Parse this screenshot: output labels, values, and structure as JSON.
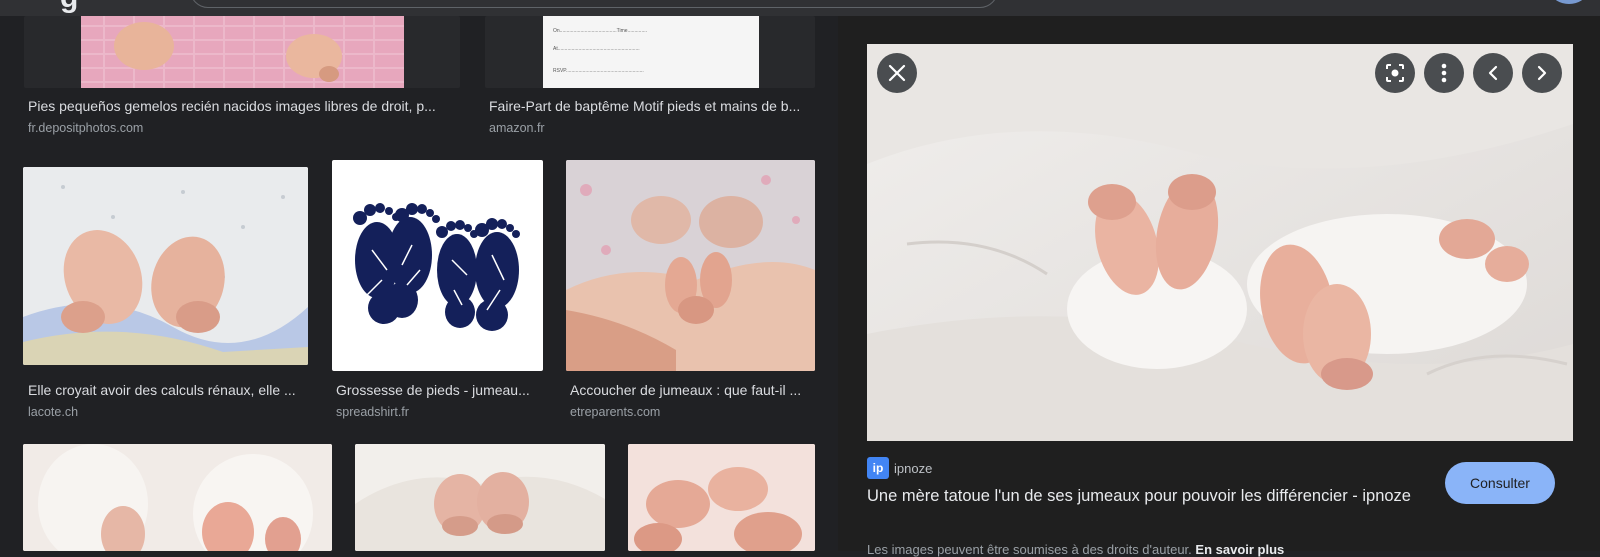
{
  "header": {
    "logo_fragment": "g"
  },
  "results": [
    {
      "caption": "Pies pequeños gemelos recién nacidos images libres de droit, p...",
      "source": "fr.depositphotos.com"
    },
    {
      "caption": "Faire-Part de baptême Motif pieds et mains de b...",
      "source": "amazon.fr"
    },
    {
      "caption": "Elle croyait avoir des calculs rénaux, elle ...",
      "source": "lacote.ch"
    },
    {
      "caption": "Grossesse de pieds - jumeau...",
      "source": "spreadshirt.fr"
    },
    {
      "caption": "Accoucher de jumeaux : que faut-il ...",
      "source": "etreparents.com"
    }
  ],
  "card_fragment": {
    "lines": [
      "On.........................................Time..............",
      "At...........................................................",
      "RSVP........................................................"
    ]
  },
  "preview": {
    "site_name": "ipnoze",
    "favicon_letter": "ip",
    "title": "Une mère tatoue l'un de ses jumeaux pour pouvoir les différencier - ipnoze",
    "consult_label": "Consulter",
    "copyright_text": "Les images peuvent être soumises à des droits d'auteur.",
    "learn_more": "En savoir plus"
  },
  "colors": {
    "accent": "#8ab4f8",
    "background": "#202124",
    "panel": "#1f1f1f"
  }
}
